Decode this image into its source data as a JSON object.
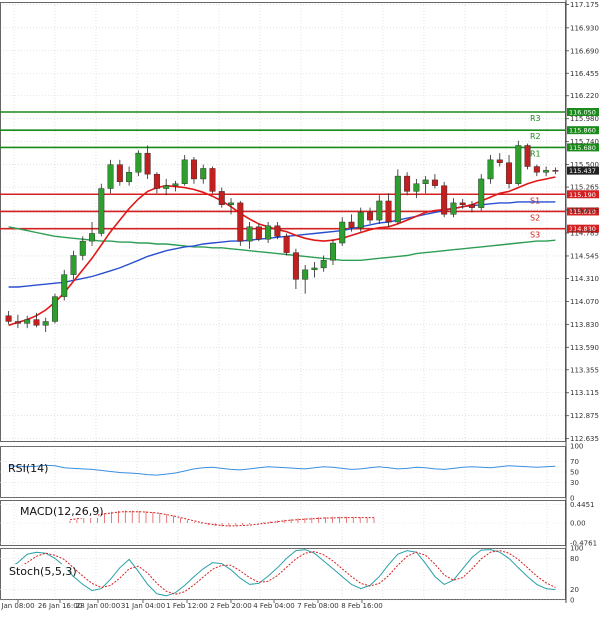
{
  "chart_data": {
    "type": "candlestick",
    "time_labels": [
      "Jan 08:00",
      "26 Jan 16:00",
      "28 Jan 00:00",
      "31 Jan 04:00",
      "1 Feb 12:00",
      "2 Feb 20:00",
      "4 Feb 04:00",
      "7 Feb 08:00",
      "8 Feb 16:00"
    ],
    "price_axis": {
      "ticks": [
        "117.175",
        "116.930",
        "116.690",
        "116.455",
        "116.220",
        "115.980",
        "115.740",
        "115.500",
        "115.265",
        "115.025",
        "114.785",
        "114.545",
        "114.310",
        "114.070",
        "113.830",
        "113.590",
        "113.355",
        "113.115",
        "112.875",
        "112.635"
      ],
      "ylim": [
        112.6,
        117.2
      ],
      "current_price": "115.437"
    },
    "levels": [
      {
        "label": "R3",
        "price": "116.050",
        "color": "#1a8a1a"
      },
      {
        "label": "R2",
        "price": "115.860",
        "color": "#1a8a1a"
      },
      {
        "label": "R1",
        "price": "115.680",
        "color": "#1a8a1a"
      },
      {
        "label": "S1",
        "price": "115.190",
        "color": "#d42020"
      },
      {
        "label": "S2",
        "price": "115.010",
        "color": "#d42020"
      },
      {
        "label": "S3",
        "price": "114.830",
        "color": "#d42020"
      }
    ],
    "candles": [
      [
        113.92,
        113.97,
        113.83,
        113.86
      ],
      [
        113.86,
        113.93,
        113.79,
        113.84
      ],
      [
        113.84,
        113.92,
        113.79,
        113.88
      ],
      [
        113.88,
        113.95,
        113.8,
        113.82
      ],
      [
        113.82,
        113.9,
        113.75,
        113.86
      ],
      [
        113.86,
        114.15,
        113.84,
        114.12
      ],
      [
        114.12,
        114.4,
        114.08,
        114.35
      ],
      [
        114.35,
        114.6,
        114.3,
        114.55
      ],
      [
        114.55,
        114.75,
        114.5,
        114.7
      ],
      [
        114.7,
        114.9,
        114.65,
        114.78
      ],
      [
        114.78,
        115.3,
        114.75,
        115.25
      ],
      [
        115.25,
        115.55,
        115.2,
        115.5
      ],
      [
        115.5,
        115.55,
        115.28,
        115.32
      ],
      [
        115.32,
        115.48,
        115.28,
        115.42
      ],
      [
        115.42,
        115.65,
        115.38,
        115.62
      ],
      [
        115.62,
        115.7,
        115.35,
        115.4
      ],
      [
        115.4,
        115.42,
        115.2,
        115.25
      ],
      [
        115.25,
        115.35,
        115.18,
        115.28
      ],
      [
        115.28,
        115.33,
        115.22,
        115.3
      ],
      [
        115.3,
        115.6,
        115.28,
        115.55
      ],
      [
        115.55,
        115.58,
        115.3,
        115.35
      ],
      [
        115.35,
        115.5,
        115.3,
        115.46
      ],
      [
        115.46,
        115.48,
        115.2,
        115.22
      ],
      [
        115.22,
        115.26,
        115.05,
        115.08
      ],
      [
        115.08,
        115.15,
        114.98,
        115.1
      ],
      [
        115.1,
        115.12,
        114.65,
        114.7
      ],
      [
        114.7,
        114.9,
        114.62,
        114.85
      ],
      [
        114.85,
        114.88,
        114.7,
        114.72
      ],
      [
        114.72,
        114.9,
        114.68,
        114.86
      ],
      [
        114.86,
        114.9,
        114.72,
        114.75
      ],
      [
        114.75,
        114.78,
        114.55,
        114.58
      ],
      [
        114.58,
        114.62,
        114.2,
        114.3
      ],
      [
        114.3,
        114.45,
        114.15,
        114.4
      ],
      [
        114.4,
        114.48,
        114.32,
        114.42
      ],
      [
        114.42,
        114.55,
        114.38,
        114.5
      ],
      [
        114.5,
        114.72,
        114.45,
        114.68
      ],
      [
        114.68,
        114.95,
        114.65,
        114.9
      ],
      [
        114.9,
        114.98,
        114.8,
        114.84
      ],
      [
        114.84,
        115.05,
        114.8,
        115.0
      ],
      [
        115.0,
        115.05,
        114.88,
        114.92
      ],
      [
        114.92,
        115.18,
        114.88,
        115.12
      ],
      [
        115.12,
        115.2,
        114.85,
        114.9
      ],
      [
        114.9,
        115.45,
        114.88,
        115.38
      ],
      [
        115.38,
        115.42,
        115.18,
        115.22
      ],
      [
        115.22,
        115.35,
        115.15,
        115.3
      ],
      [
        115.3,
        115.38,
        115.2,
        115.34
      ],
      [
        115.34,
        115.4,
        115.25,
        115.28
      ],
      [
        115.28,
        115.32,
        114.95,
        114.98
      ],
      [
        114.98,
        115.15,
        114.95,
        115.1
      ],
      [
        115.1,
        115.14,
        115.04,
        115.08
      ],
      [
        115.08,
        115.12,
        115.0,
        115.05
      ],
      [
        115.05,
        115.4,
        115.02,
        115.35
      ],
      [
        115.35,
        115.6,
        115.3,
        115.55
      ],
      [
        115.55,
        115.62,
        115.48,
        115.52
      ],
      [
        115.52,
        115.6,
        115.25,
        115.3
      ],
      [
        115.3,
        115.75,
        115.28,
        115.7
      ],
      [
        115.7,
        115.72,
        115.45,
        115.48
      ],
      [
        115.48,
        115.5,
        115.38,
        115.42
      ],
      [
        115.42,
        115.48,
        115.38,
        115.44
      ],
      [
        115.44,
        115.47,
        115.4,
        115.437
      ]
    ],
    "ma_red": [
      113.82,
      113.85,
      113.88,
      113.92,
      113.98,
      114.06,
      114.16,
      114.28,
      114.4,
      114.52,
      114.66,
      114.8,
      114.92,
      115.04,
      115.14,
      115.22,
      115.26,
      115.28,
      115.27,
      115.26,
      115.24,
      115.21,
      115.17,
      115.12,
      115.06,
      114.99,
      114.93,
      114.88,
      114.85,
      114.82,
      114.8,
      114.76,
      114.73,
      114.71,
      114.7,
      114.71,
      114.73,
      114.76,
      114.79,
      114.82,
      114.84,
      114.85,
      114.88,
      114.92,
      114.96,
      115.0,
      115.02,
      115.03,
      115.04,
      115.06,
      115.08,
      115.12,
      115.16,
      115.2,
      115.22,
      115.26,
      115.3,
      115.33,
      115.35,
      115.37
    ],
    "ma_blue": [
      114.22,
      114.22,
      114.23,
      114.24,
      114.25,
      114.26,
      114.27,
      114.29,
      114.31,
      114.33,
      114.36,
      114.39,
      114.42,
      114.46,
      114.5,
      114.54,
      114.57,
      114.6,
      114.62,
      114.64,
      114.65,
      114.67,
      114.68,
      114.69,
      114.7,
      114.7,
      114.71,
      114.72,
      114.73,
      114.74,
      114.75,
      114.76,
      114.77,
      114.78,
      114.79,
      114.8,
      114.81,
      114.83,
      114.85,
      114.87,
      114.89,
      114.9,
      114.92,
      114.94,
      114.96,
      114.98,
      115.0,
      115.02,
      115.04,
      115.06,
      115.07,
      115.08,
      115.09,
      115.1,
      115.1,
      115.11,
      115.11,
      115.11,
      115.11,
      115.11
    ],
    "ma_green": [
      114.85,
      114.83,
      114.81,
      114.79,
      114.77,
      114.75,
      114.74,
      114.73,
      114.72,
      114.71,
      114.7,
      114.7,
      114.69,
      114.69,
      114.68,
      114.68,
      114.67,
      114.67,
      114.66,
      114.65,
      114.64,
      114.64,
      114.63,
      114.63,
      114.62,
      114.61,
      114.6,
      114.59,
      114.58,
      114.57,
      114.56,
      114.55,
      114.54,
      114.53,
      114.52,
      114.51,
      114.5,
      114.5,
      114.5,
      114.51,
      114.52,
      114.53,
      114.54,
      114.55,
      114.57,
      114.58,
      114.59,
      114.6,
      114.61,
      114.62,
      114.63,
      114.64,
      114.65,
      114.66,
      114.67,
      114.68,
      114.69,
      114.7,
      114.7,
      114.71
    ],
    "indicators": [
      {
        "name": "RSI(14)",
        "ticks": [
          "100",
          "70",
          "50",
          "30",
          "0"
        ],
        "ylim": [
          0,
          100
        ],
        "values": [
          62,
          61,
          60,
          61,
          63,
          62,
          58,
          57,
          56,
          55,
          53,
          51,
          49,
          48,
          47,
          45,
          44,
          46,
          48,
          52,
          56,
          58,
          59,
          57,
          55,
          54,
          56,
          58,
          60,
          59,
          58,
          57,
          56,
          58,
          60,
          59,
          57,
          55,
          56,
          58,
          60,
          58,
          56,
          57,
          59,
          58,
          56,
          55,
          57,
          59,
          60,
          59,
          58,
          60,
          62,
          61,
          60,
          59,
          60,
          61
        ]
      },
      {
        "name": "MACD(12,26,9)",
        "ticks": [
          "0.4451",
          "0.00",
          "-0.4761"
        ],
        "ylim": [
          -0.55,
          0.55
        ],
        "hist": [
          0.05,
          0.08,
          0.12,
          0.16,
          0.2,
          0.24,
          0.27,
          0.29,
          0.3,
          0.3,
          0.29,
          0.28,
          0.26,
          0.24,
          0.21,
          0.17,
          0.12,
          0.07,
          0.02,
          -0.02,
          -0.05,
          -0.07,
          -0.08,
          -0.08,
          -0.07,
          -0.05,
          -0.03,
          0.0,
          0.02,
          0.04,
          0.06,
          0.08,
          0.1,
          0.11,
          0.12,
          0.13,
          0.14,
          0.14,
          0.15,
          0.15,
          0.15,
          0.14,
          0.14,
          0.13,
          0.13
        ],
        "signal": [
          0.08,
          0.1,
          0.13,
          0.16,
          0.19,
          0.22,
          0.24,
          0.26,
          0.27,
          0.27,
          0.27,
          0.26,
          0.25,
          0.23,
          0.2,
          0.17,
          0.13,
          0.09,
          0.05,
          0.01,
          -0.02,
          -0.04,
          -0.06,
          -0.07,
          -0.07,
          -0.06,
          -0.05,
          -0.03,
          -0.01,
          0.01,
          0.03,
          0.05,
          0.07,
          0.08,
          0.09,
          0.1,
          0.11,
          0.12,
          0.12,
          0.13,
          0.13,
          0.13,
          0.13,
          0.13,
          0.13
        ]
      },
      {
        "name": "Stoch(5,5,3)",
        "ticks": [
          "100",
          "80",
          "20",
          "0"
        ],
        "ylim": [
          0,
          100
        ],
        "k": [
          60,
          72,
          88,
          92,
          90,
          80,
          65,
          45,
          30,
          18,
          22,
          40,
          62,
          78,
          55,
          30,
          12,
          8,
          14,
          28,
          45,
          60,
          72,
          70,
          58,
          42,
          30,
          32,
          46,
          62,
          80,
          95,
          97,
          90,
          75,
          60,
          45,
          30,
          22,
          28,
          45,
          68,
          88,
          95,
          92,
          70,
          45,
          30,
          38,
          60,
          82,
          96,
          97,
          92,
          80,
          62,
          45,
          30,
          22,
          20
        ],
        "d": [
          55,
          62,
          72,
          84,
          90,
          86,
          78,
          62,
          46,
          32,
          24,
          28,
          42,
          60,
          65,
          52,
          32,
          17,
          11,
          16,
          29,
          44,
          59,
          67,
          67,
          56,
          43,
          34,
          36,
          47,
          63,
          79,
          90,
          93,
          87,
          75,
          60,
          45,
          32,
          27,
          32,
          47,
          67,
          84,
          92,
          86,
          69,
          48,
          38,
          43,
          60,
          79,
          92,
          95,
          90,
          78,
          62,
          46,
          33,
          24
        ]
      }
    ]
  },
  "colors": {
    "bull": "#2e9e2e",
    "bear": "#c02020",
    "ma_red": "#e01818",
    "ma_blue": "#2a4fd0",
    "ma_green": "#2e9e55",
    "indicator_line": "#3a8fe0",
    "macd_hist": "#d44",
    "macd_signal": "#d42020",
    "stoch_k": "#2aa0a8",
    "stoch_d": "#d42020"
  }
}
